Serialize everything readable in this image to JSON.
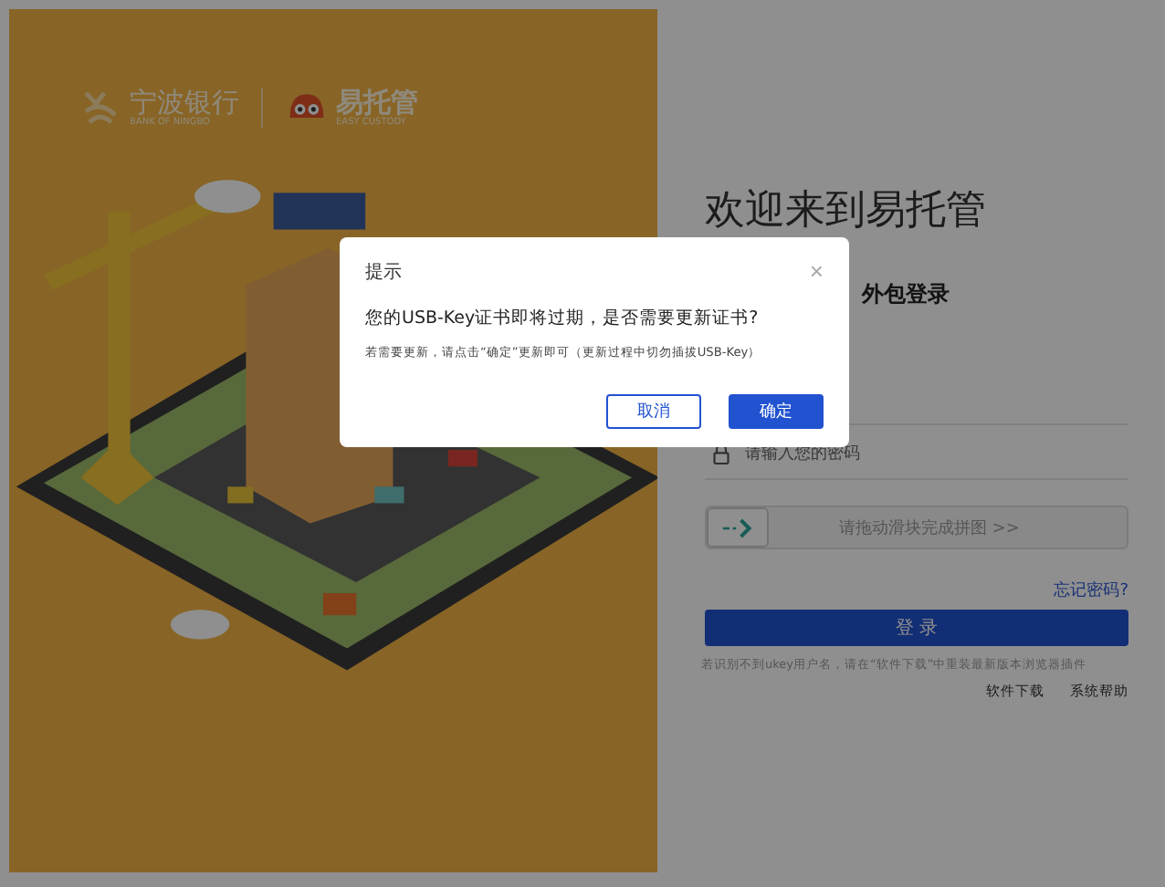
{
  "brand": {
    "bank_name": "宁波银行",
    "bank_name_en": "BANK OF NINGBO",
    "product_name": "易托管",
    "product_name_en": "EASY CUSTODY"
  },
  "login": {
    "title": "欢迎来到易托管",
    "subtitle": "外包登录",
    "password": {
      "placeholder": "请输入您的密码"
    },
    "slider": {
      "label": "请拖动滑块完成拼图 >>",
      "level": 0
    },
    "forgot_link": "忘记密码?",
    "login_button": "登 录",
    "note": "若识别不到ukey用户名，请在“软件下载”中重装最新版本浏览器插件",
    "links": [
      "软件下载",
      "系统帮助"
    ]
  },
  "dialog": {
    "title": "提示",
    "close": "×",
    "message": "您的USB-Key证书即将过期，是否需要更新证书?",
    "detail": "若需要更新，请点击“确定”更新即可（更新过程中切勿插拔USB-Key）",
    "buttons": [
      {
        "label": "取消",
        "primary": false
      },
      {
        "label": "确定",
        "primary": true
      }
    ]
  }
}
